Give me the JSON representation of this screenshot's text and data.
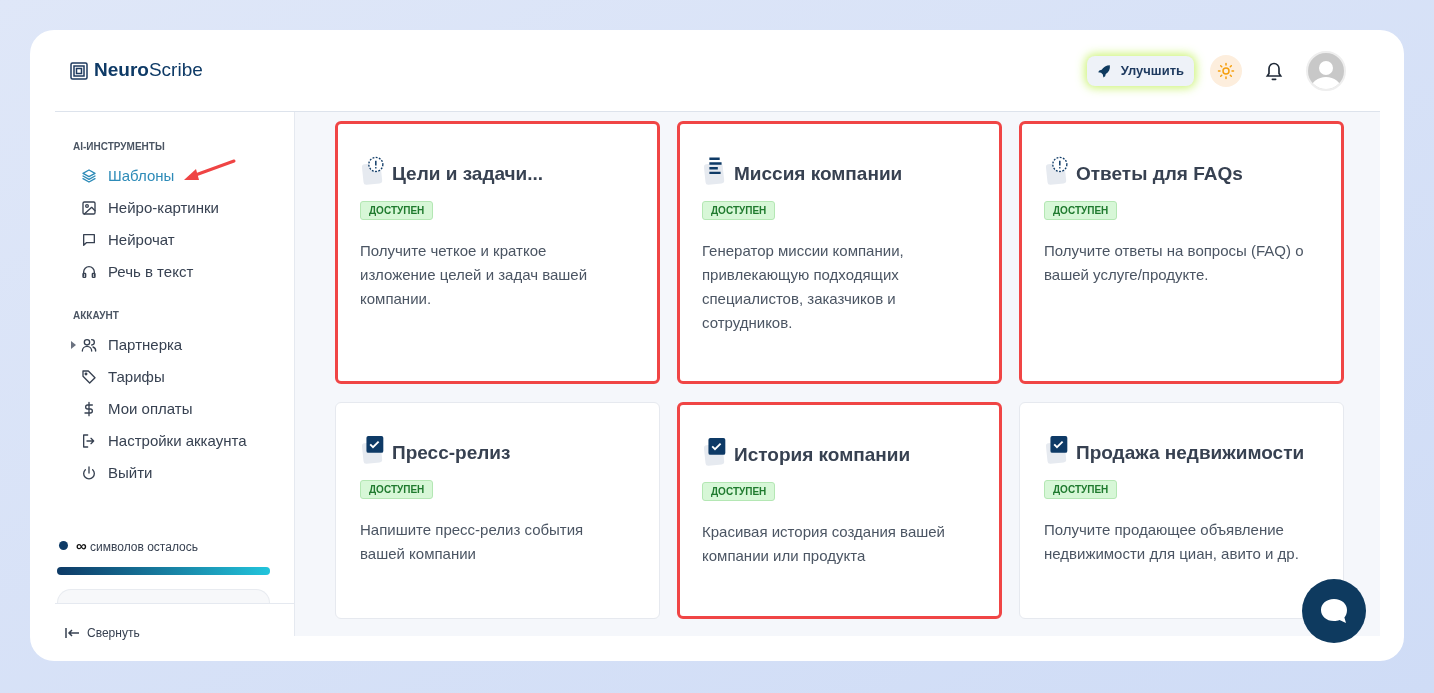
{
  "logo": {
    "bold": "Neuro",
    "light": "Scribe"
  },
  "header": {
    "upgrade_button": "Улучшить"
  },
  "sidebar": {
    "sections": [
      {
        "title": "AI-ИНСТРУМЕНТЫ",
        "items": [
          {
            "label": "Шаблоны",
            "kind": "layers",
            "selected": true,
            "has_submenu": false
          },
          {
            "label": "Нейро-картинки",
            "kind": "image",
            "selected": false,
            "has_submenu": false
          },
          {
            "label": "Нейрочат",
            "kind": "chat",
            "selected": false,
            "has_submenu": false
          },
          {
            "label": "Речь в текст",
            "kind": "headphones",
            "selected": false,
            "has_submenu": false
          }
        ]
      },
      {
        "title": "АККАУНТ",
        "items": [
          {
            "label": "Партнерка",
            "kind": "users",
            "selected": false,
            "has_submenu": true
          },
          {
            "label": "Тарифы",
            "kind": "tag",
            "selected": false,
            "has_submenu": false
          },
          {
            "label": "Мои оплаты",
            "kind": "dollar",
            "selected": false,
            "has_submenu": false
          },
          {
            "label": "Настройки аккаунта",
            "kind": "exit",
            "selected": false,
            "has_submenu": false
          },
          {
            "label": "Выйти",
            "kind": "power",
            "selected": false,
            "has_submenu": false
          }
        ]
      }
    ],
    "usage": {
      "amount": "∞",
      "label": "символов осталось",
      "level": 1
    },
    "collapse": "Свернуть"
  },
  "annotation_arrow": true,
  "templates": [
    {
      "kind": "alert",
      "title": "Цели и задачи...",
      "badge": "ДОСТУПЕН",
      "description": "Получите четкое и краткое изложение целей и задач вашей компании.",
      "highlighted": true
    },
    {
      "kind": "list",
      "title": "Миссия компании",
      "badge": "ДОСТУПЕН",
      "description": "Генератор миссии компании, привлекающую подходящих специалистов, заказчиков и сотрудников.",
      "highlighted": true
    },
    {
      "kind": "alert",
      "title": "Ответы для FAQs",
      "badge": "ДОСТУПЕН",
      "description": "Получите ответы на вопросы (FAQ) о вашей услуге/продукте.",
      "highlighted": true
    },
    {
      "kind": "check",
      "title": "Пресс-релиз",
      "badge": "ДОСТУПЕН",
      "description": "Напишите пресс-релиз события вашей компании",
      "highlighted": false
    },
    {
      "kind": "check",
      "title": "История компании",
      "badge": "ДОСТУПЕН",
      "description": "Красивая история создания вашей компании или продукта",
      "highlighted": true
    },
    {
      "kind": "check",
      "title": "Продажа недвижимости",
      "badge": "ДОСТУПЕН",
      "description": "Получите продающее объявление недвижимости для циан, авито и др.",
      "highlighted": false
    }
  ]
}
